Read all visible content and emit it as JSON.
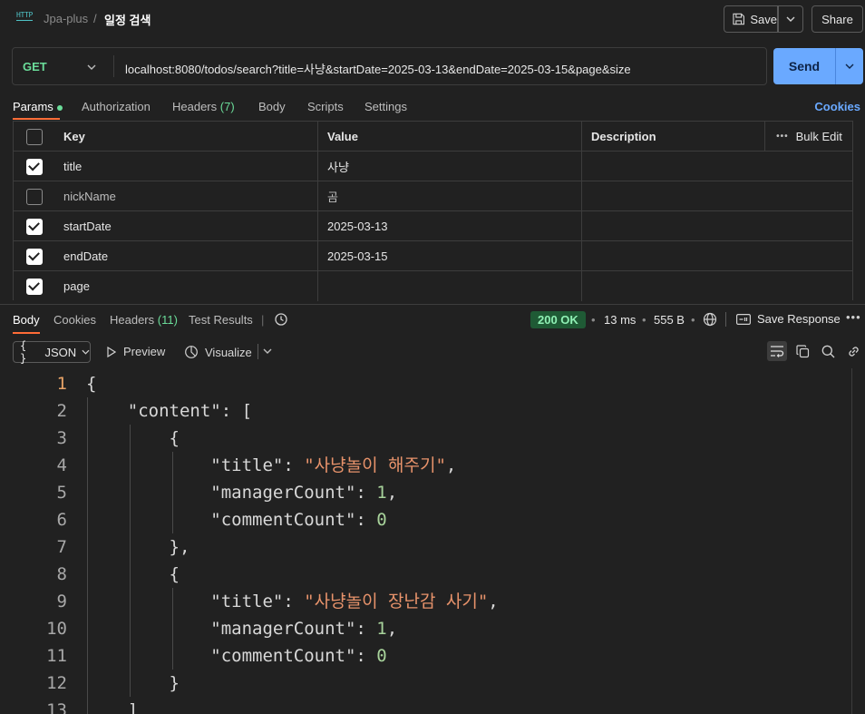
{
  "header": {
    "http_icon_text": "HTTP",
    "breadcrumb_parent": "Jpa-plus",
    "breadcrumb_sep": "/",
    "breadcrumb_current": "일정 검색",
    "save_label": "Save",
    "share_label": "Share"
  },
  "request": {
    "method": "GET",
    "url": "localhost:8080/todos/search?title=사냥&startDate=2025-03-13&endDate=2025-03-15&page&size",
    "send_label": "Send"
  },
  "req_tabs": {
    "params": "Params",
    "authorization": "Authorization",
    "headers": "Headers",
    "headers_count": "(7)",
    "body": "Body",
    "scripts": "Scripts",
    "settings": "Settings",
    "cookies": "Cookies"
  },
  "params_table": {
    "headers": {
      "key": "Key",
      "value": "Value",
      "description": "Description",
      "bulk_edit": "Bulk Edit"
    },
    "rows": [
      {
        "checked": true,
        "key": "title",
        "value": "사냥",
        "description": ""
      },
      {
        "checked": false,
        "key": "nickName",
        "value": "곰",
        "description": ""
      },
      {
        "checked": true,
        "key": "startDate",
        "value": "2025-03-13",
        "description": ""
      },
      {
        "checked": true,
        "key": "endDate",
        "value": "2025-03-15",
        "description": ""
      },
      {
        "checked": true,
        "key": "page",
        "value": "",
        "description": ""
      }
    ]
  },
  "response": {
    "tabs": {
      "body": "Body",
      "cookies": "Cookies",
      "headers": "Headers",
      "headers_count": "(11)",
      "test_results": "Test Results"
    },
    "status": "200 OK",
    "time": "13 ms",
    "size": "555 B",
    "save_response": "Save Response",
    "format": "JSON",
    "preview": "Preview",
    "visualize": "Visualize"
  },
  "code_lines": [
    {
      "num": "1",
      "text": "{"
    },
    {
      "num": "2",
      "text": "    \"content\": ["
    },
    {
      "num": "3",
      "text": "        {"
    },
    {
      "num": "4",
      "text": "            \"title\": \"사냥놀이 해주기\","
    },
    {
      "num": "5",
      "text": "            \"managerCount\": 1,"
    },
    {
      "num": "6",
      "text": "            \"commentCount\": 0"
    },
    {
      "num": "7",
      "text": "        },"
    },
    {
      "num": "8",
      "text": "        {"
    },
    {
      "num": "9",
      "text": "            \"title\": \"사냥놀이 장난감 사기\","
    },
    {
      "num": "10",
      "text": "            \"managerCount\": 1,"
    },
    {
      "num": "11",
      "text": "            \"commentCount\": 0"
    },
    {
      "num": "12",
      "text": "        }"
    },
    {
      "num": "13",
      "text": "    ]"
    }
  ],
  "colors": {
    "accent": "#ff6c37",
    "send": "#6aa9ff",
    "method": "#6bdd9a",
    "status_bg": "#1f5a35",
    "string": "#e8936b",
    "number": "#a8d39b"
  }
}
